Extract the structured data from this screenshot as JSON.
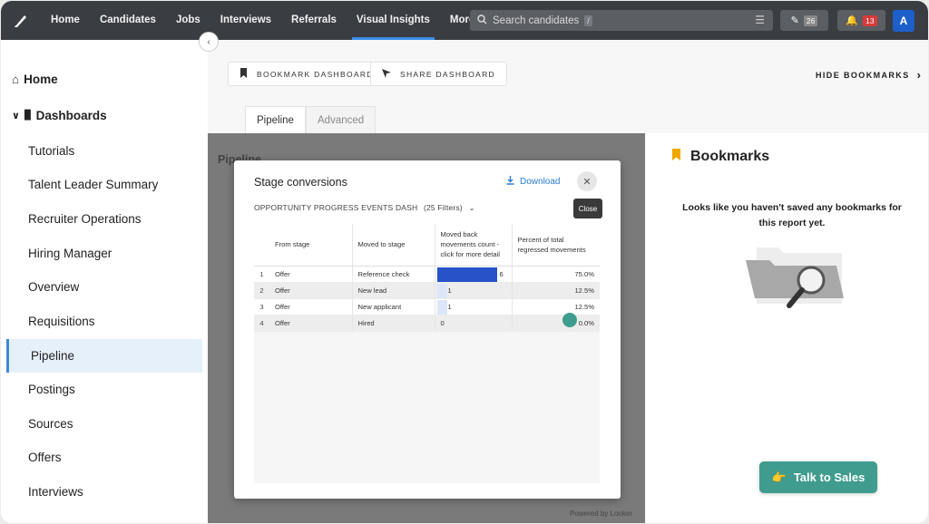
{
  "nav": {
    "items": [
      {
        "label": "Home",
        "active": false
      },
      {
        "label": "Candidates",
        "active": false
      },
      {
        "label": "Jobs",
        "active": false
      },
      {
        "label": "Interviews",
        "active": false
      },
      {
        "label": "Referrals",
        "active": false
      },
      {
        "label": "Visual Insights",
        "active": true
      },
      {
        "label": "More",
        "active": false
      }
    ],
    "search_placeholder": "Search candidates",
    "search_shortcut": "/",
    "edit_count": "26",
    "notification_count": "13",
    "avatar_initial": "A",
    "accent_color": "#3a8de6"
  },
  "sidebar": {
    "home": "Home",
    "dashboards": "Dashboards",
    "items": [
      "Tutorials",
      "Talent Leader Summary",
      "Recruiter Operations",
      "Hiring Manager",
      "Overview",
      "Requisitions",
      "Pipeline",
      "Postings",
      "Sources",
      "Offers",
      "Interviews"
    ],
    "active_item": "Pipeline"
  },
  "header": {
    "bookmark_dashboard": "BOOKMARK DASHBOARD",
    "share_dashboard": "SHARE DASHBOARD",
    "hide_bookmarks": "HIDE BOOKMARKS",
    "tabs": [
      {
        "label": "Pipeline",
        "active": true
      },
      {
        "label": "Advanced",
        "active": false
      }
    ]
  },
  "dashboard": {
    "title": "Pipeline",
    "powered_by": "Powered by Looker"
  },
  "bookmarks": {
    "title": "Bookmarks",
    "empty_message": "Looks like you haven't saved any bookmarks for this report yet.",
    "talk_to_sales": "Talk to Sales"
  },
  "modal": {
    "title": "Stage conversions",
    "download": "Download",
    "close_tooltip": "Close",
    "subtitle": "OPPORTUNITY PROGRESS EVENTS DASH",
    "filters": "(25 Filters)",
    "columns": [
      "From stage",
      "Moved to stage",
      "Moved back movements count - click for more detail",
      "Percent of total regressed movements"
    ],
    "rows": [
      {
        "index": "1",
        "from": "Offer",
        "to": "Reference check",
        "count": 6,
        "percent": "75.0%"
      },
      {
        "index": "2",
        "from": "Offer",
        "to": "New lead",
        "count": 1,
        "percent": "12.5%"
      },
      {
        "index": "3",
        "from": "Offer",
        "to": "New applicant",
        "count": 1,
        "percent": "12.5%"
      },
      {
        "index": "4",
        "from": "Offer",
        "to": "Hired",
        "count": 0,
        "percent": "0.0%"
      }
    ],
    "bar_color": "#2653c8"
  }
}
